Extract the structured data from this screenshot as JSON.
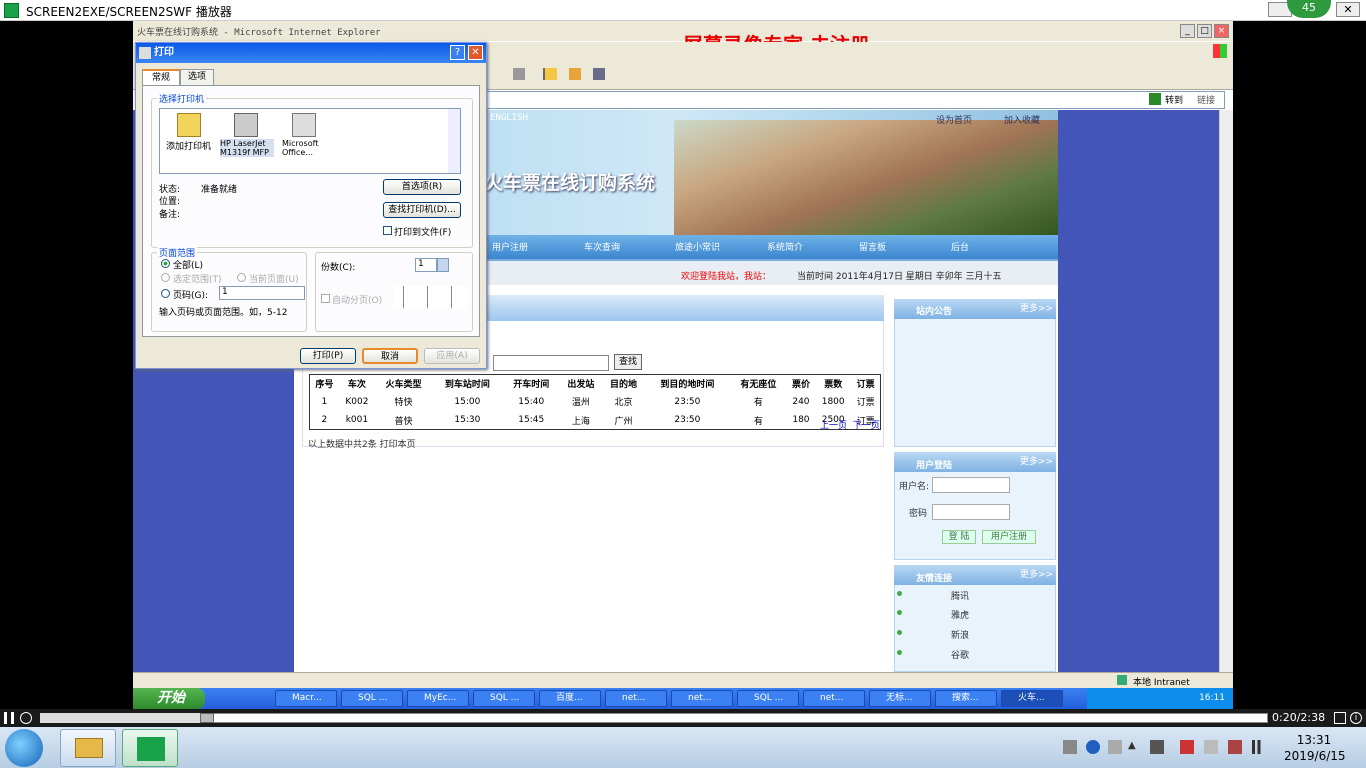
{
  "player": {
    "title": "SCREEN2EXE/SCREEN2SWF 播放器",
    "badge": "45",
    "time": "0:20/2:38"
  },
  "ie": {
    "title": "火车票在线订购系统 - Microsoft Internet Explorer",
    "watermark": "屏幕录像专家  未注册",
    "go": "转到",
    "links": "链接",
    "status_zone": "本地 Intranet"
  },
  "site": {
    "english": "ENGLISH",
    "title": "火车票在线订购系统",
    "set_home": "设为首页",
    "favorite": "加入收藏",
    "nav": [
      "用户注册",
      "车次查询",
      "旅途小常识",
      "系统简介",
      "留言板",
      "后台"
    ],
    "welcome": "欢迎登陆我站，我站：",
    "current_time": "当前时间    2011年4月17日  星期日  辛卯年  三月十五",
    "search_btn": "查找",
    "table": {
      "headers": [
        "序号",
        "车次",
        "火车类型",
        "到车站时间",
        "开车时间",
        "出发站",
        "目的地",
        "到目的地时间",
        "有无座位",
        "票价",
        "票数",
        "订票"
      ],
      "rows": [
        [
          "1",
          "K002",
          "特快",
          "15:00",
          "15:40",
          "温州",
          "北京",
          "23:50",
          "有",
          "240",
          "1800",
          "订票"
        ],
        [
          "2",
          "k001",
          "普快",
          "15:30",
          "15:45",
          "上海",
          "广州",
          "23:50",
          "有",
          "180",
          "2500",
          "订票"
        ]
      ]
    },
    "prev": "上一页",
    "next": "下一页",
    "summary": "以上数据中共2条  打印本页",
    "notice_title": "站内公告",
    "more": "更多>>",
    "login_title": "用户登陆",
    "username_label": "用户名:",
    "password_label": "密码",
    "login_btn": "登 陆",
    "register_btn": "用户注册",
    "links_title": "友情连接",
    "friend_links": [
      "腾讯",
      "雅虎",
      "新浪",
      "谷歌"
    ]
  },
  "print": {
    "title": "打印",
    "tab_general": "常规",
    "tab_options": "选项",
    "select_printer": "选择打印机",
    "printers": [
      "添加打印机",
      "HP LaserJet M1319f MFP",
      "Microsoft Office..."
    ],
    "status_label": "状态:",
    "status_value": "准备就绪",
    "location_label": "位置:",
    "comment_label": "备注:",
    "prefs_btn": "首选项(R)",
    "find_btn": "查找打印机(D)...",
    "print_to_file": "打印到文件(F)",
    "range_title": "页面范围",
    "all": "全部(L)",
    "selection": "选定范围(T)",
    "current_page": "当前页面(U)",
    "pages": "页码(G):",
    "pages_value": "1",
    "hint": "输入页码或页面范围。如，5-12",
    "copies_label": "份数(C):",
    "copies_value": "1",
    "collate": "自动分页(O)",
    "print_btn": "打印(P)",
    "cancel_btn": "取消",
    "apply_btn": "应用(A)"
  },
  "xp_taskbar": {
    "start": "开始",
    "items": [
      "Macr...",
      "SQL ...",
      "MyEc...",
      "SQL ...",
      "百度...",
      "net...",
      "net...",
      "SQL ...",
      "net...",
      "无标...",
      "搜索...",
      "火车..."
    ],
    "clock": "16:11"
  },
  "win7": {
    "time": "13:31",
    "date": "2019/6/15"
  }
}
